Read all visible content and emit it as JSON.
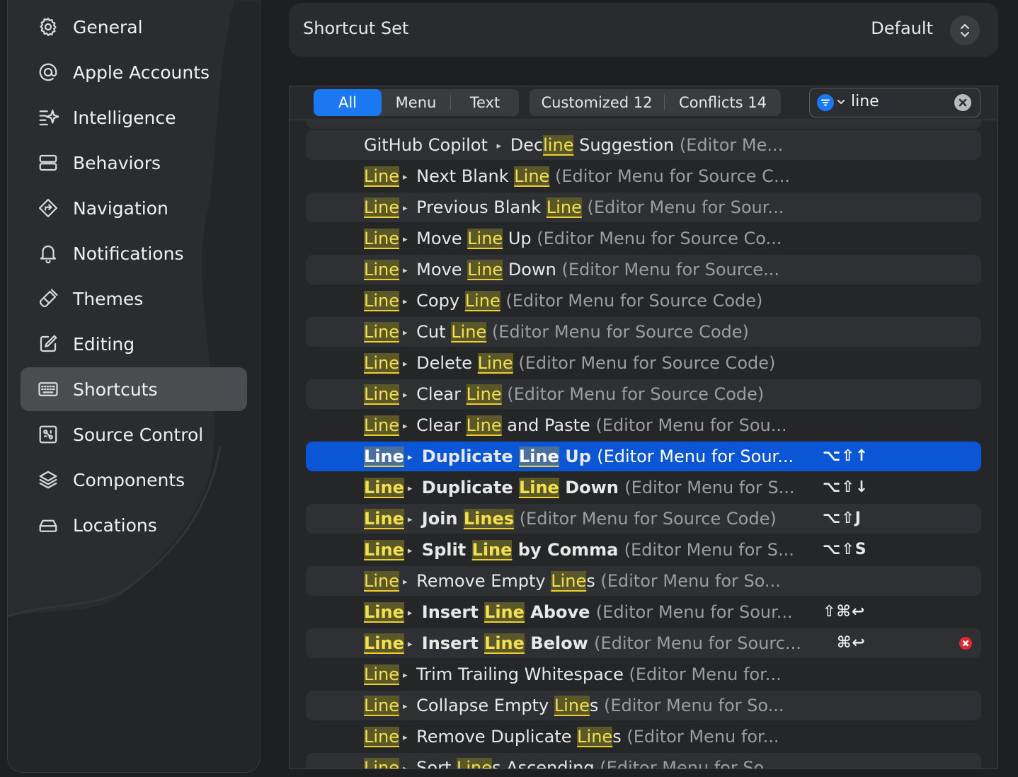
{
  "sidebar": {
    "items": [
      {
        "id": "general",
        "label": "General",
        "icon": "gear-icon"
      },
      {
        "id": "apple-accounts",
        "label": "Apple Accounts",
        "icon": "at-sign-icon"
      },
      {
        "id": "intelligence",
        "label": "Intelligence",
        "icon": "sparkle-icon"
      },
      {
        "id": "behaviors",
        "label": "Behaviors",
        "icon": "behaviors-icon"
      },
      {
        "id": "navigation",
        "label": "Navigation",
        "icon": "navigation-diamond-icon"
      },
      {
        "id": "notifications",
        "label": "Notifications",
        "icon": "bell-icon"
      },
      {
        "id": "themes",
        "label": "Themes",
        "icon": "paintbrush-icon"
      },
      {
        "id": "editing",
        "label": "Editing",
        "icon": "pencil-square-icon"
      },
      {
        "id": "shortcuts",
        "label": "Shortcuts",
        "icon": "keyboard-icon",
        "active": true
      },
      {
        "id": "source-control",
        "label": "Source Control",
        "icon": "source-control-icon"
      },
      {
        "id": "components",
        "label": "Components",
        "icon": "layers-icon"
      },
      {
        "id": "locations",
        "label": "Locations",
        "icon": "drive-icon"
      }
    ]
  },
  "shortcut_set": {
    "label": "Shortcut Set",
    "value": "Default"
  },
  "filters": {
    "all": "All",
    "menu": "Menu",
    "text": "Text",
    "customized": "Customized 12",
    "conflicts": "Conflicts 14",
    "selected": "All"
  },
  "search": {
    "value": "line",
    "filter_icon": "filter-icon",
    "clear_icon": "clear-icon"
  },
  "rows": [
    {
      "parts": [
        {
          "t": "GitHub Copilot "
        },
        {
          "a": 1
        },
        {
          "t": " Dec"
        },
        {
          "m": "line"
        },
        {
          "t": " Suggestion "
        },
        {
          "c": "(Editor Me..."
        }
      ],
      "key": ""
    },
    {
      "parts": [
        {
          "m": "Line"
        },
        {
          "a": 1
        },
        {
          "t": " Next Blank "
        },
        {
          "m": "Line"
        },
        {
          "t": " "
        },
        {
          "c": "(Editor Menu for Source C..."
        }
      ],
      "key": ""
    },
    {
      "parts": [
        {
          "m": "Line"
        },
        {
          "a": 1
        },
        {
          "t": " Previous Blank "
        },
        {
          "m": "Line"
        },
        {
          "t": " "
        },
        {
          "c": "(Editor Menu for Sour..."
        }
      ],
      "key": ""
    },
    {
      "parts": [
        {
          "m": "Line"
        },
        {
          "a": 1
        },
        {
          "t": " Move "
        },
        {
          "m": "Line"
        },
        {
          "t": " Up "
        },
        {
          "c": "(Editor Menu for Source Co..."
        }
      ],
      "key": ""
    },
    {
      "parts": [
        {
          "m": "Line"
        },
        {
          "a": 1
        },
        {
          "t": " Move "
        },
        {
          "m": "Line"
        },
        {
          "t": " Down "
        },
        {
          "c": "(Editor Menu for Source..."
        }
      ],
      "key": ""
    },
    {
      "parts": [
        {
          "m": "Line"
        },
        {
          "a": 1
        },
        {
          "t": " Copy "
        },
        {
          "m": "Line"
        },
        {
          "t": " "
        },
        {
          "c": "(Editor Menu for Source Code)"
        }
      ],
      "key": ""
    },
    {
      "parts": [
        {
          "m": "Line"
        },
        {
          "a": 1
        },
        {
          "t": " Cut "
        },
        {
          "m": "Line"
        },
        {
          "t": " "
        },
        {
          "c": "(Editor Menu for Source Code)"
        }
      ],
      "key": ""
    },
    {
      "parts": [
        {
          "m": "Line"
        },
        {
          "a": 1
        },
        {
          "t": " Delete "
        },
        {
          "m": "Line"
        },
        {
          "t": " "
        },
        {
          "c": "(Editor Menu for Source Code)"
        }
      ],
      "key": ""
    },
    {
      "parts": [
        {
          "m": "Line"
        },
        {
          "a": 1
        },
        {
          "t": " Clear "
        },
        {
          "m": "Line"
        },
        {
          "t": " "
        },
        {
          "c": "(Editor Menu for Source Code)"
        }
      ],
      "key": ""
    },
    {
      "parts": [
        {
          "m": "Line"
        },
        {
          "a": 1
        },
        {
          "t": " Clear "
        },
        {
          "m": "Line"
        },
        {
          "t": " and Paste "
        },
        {
          "c": "(Editor Menu for Sou..."
        }
      ],
      "key": ""
    },
    {
      "parts": [
        {
          "m": "Line",
          "b": 1
        },
        {
          "a": 1
        },
        {
          "t": " Duplicate ",
          "b": 1
        },
        {
          "m": "Line",
          "b": 1
        },
        {
          "t": " Up ",
          "b": 1
        },
        {
          "c": "(Editor Menu for Sour..."
        }
      ],
      "key": "⌥⇧↑",
      "selected": true
    },
    {
      "parts": [
        {
          "m": "Line",
          "b": 1
        },
        {
          "a": 1
        },
        {
          "t": " Duplicate ",
          "b": 1
        },
        {
          "m": "Line",
          "b": 1
        },
        {
          "t": " Down ",
          "b": 1
        },
        {
          "c": "(Editor Menu for S..."
        }
      ],
      "key": "⌥⇧↓"
    },
    {
      "parts": [
        {
          "m": "Line",
          "b": 1
        },
        {
          "a": 1
        },
        {
          "t": " Join ",
          "b": 1
        },
        {
          "m": "Lines",
          "b": 1
        },
        {
          "t": " "
        },
        {
          "c": "(Editor Menu for Source Code)"
        }
      ],
      "key": "⌥⇧J"
    },
    {
      "parts": [
        {
          "m": "Line",
          "b": 1
        },
        {
          "a": 1
        },
        {
          "t": " Split ",
          "b": 1
        },
        {
          "m": "Line",
          "b": 1
        },
        {
          "t": " by Comma ",
          "b": 1
        },
        {
          "c": "(Editor Menu for S..."
        }
      ],
      "key": "⌥⇧S"
    },
    {
      "parts": [
        {
          "m": "Line"
        },
        {
          "a": 1
        },
        {
          "t": " Remove Empty "
        },
        {
          "m": "Line"
        },
        {
          "t": "s "
        },
        {
          "c": "(Editor Menu for So..."
        }
      ],
      "key": ""
    },
    {
      "parts": [
        {
          "m": "Line",
          "b": 1
        },
        {
          "a": 1
        },
        {
          "t": " Insert ",
          "b": 1
        },
        {
          "m": "Line",
          "b": 1
        },
        {
          "t": " Above ",
          "b": 1
        },
        {
          "c": "(Editor Menu for Sour..."
        }
      ],
      "key": "⇧⌘↩"
    },
    {
      "parts": [
        {
          "m": "Line",
          "b": 1
        },
        {
          "a": 1
        },
        {
          "t": " Insert ",
          "b": 1
        },
        {
          "m": "Line",
          "b": 1
        },
        {
          "t": " Below ",
          "b": 1
        },
        {
          "c": "(Editor Menu for Sourc..."
        }
      ],
      "key": "⌘↩",
      "conflict": true
    },
    {
      "parts": [
        {
          "m": "Line"
        },
        {
          "a": 1
        },
        {
          "t": " Trim Trailing Whitespace "
        },
        {
          "c": "(Editor Menu for..."
        }
      ],
      "key": ""
    },
    {
      "parts": [
        {
          "m": "Line"
        },
        {
          "a": 1
        },
        {
          "t": " Collapse Empty "
        },
        {
          "m": "Line"
        },
        {
          "t": "s "
        },
        {
          "c": "(Editor Menu for So..."
        }
      ],
      "key": ""
    },
    {
      "parts": [
        {
          "m": "Line"
        },
        {
          "a": 1
        },
        {
          "t": " Remove Duplicate "
        },
        {
          "m": "Line"
        },
        {
          "t": "s "
        },
        {
          "c": "(Editor Menu for..."
        }
      ],
      "key": ""
    },
    {
      "parts": [
        {
          "m": "Line"
        },
        {
          "a": 1
        },
        {
          "t": " Sort "
        },
        {
          "m": "Line"
        },
        {
          "t": "s Ascending "
        },
        {
          "c": "(Editor Menu for So..."
        }
      ],
      "key": ""
    }
  ],
  "colors": {
    "accent": "#1a78f2",
    "selected_row": "#0a56d6",
    "match_highlight": "#f4e04f",
    "conflict": "#e5282f"
  }
}
